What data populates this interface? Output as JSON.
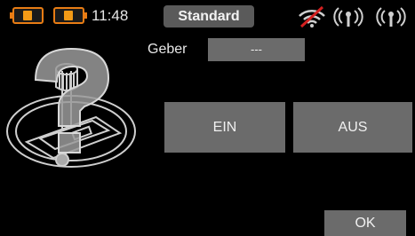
{
  "statusbar": {
    "time": "11:48",
    "model_name": "Standard",
    "battery_color": "#f39a16",
    "icons": [
      "battery-left-icon",
      "battery-right-icon",
      "wifi-icon",
      "antenna-signal-icon",
      "antenna-signal-icon"
    ]
  },
  "main": {
    "geber_label": "Geber",
    "geber_value": "---",
    "illustration_icon": "question-mark-joystick-icon",
    "ein_label": "EIN",
    "aus_label": "AUS",
    "ok_label": "OK"
  },
  "colors": {
    "background": "#000000",
    "button": "#6b6b6b",
    "accent_orange": "#e87c14",
    "wifi_red": "#d42020"
  }
}
